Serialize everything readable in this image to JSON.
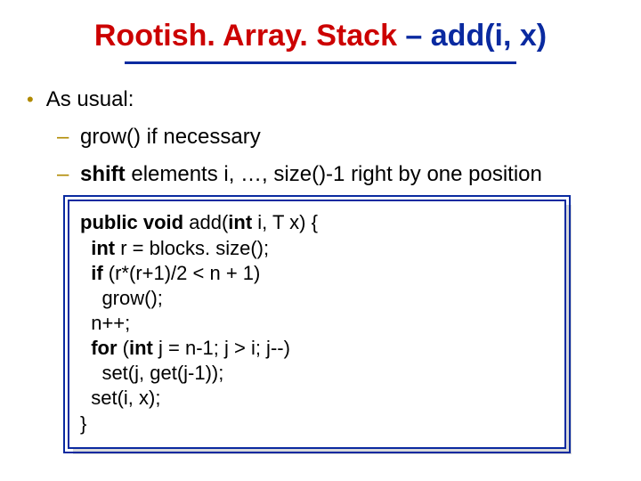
{
  "title": {
    "part1": "Rootish. Array. Stack ",
    "part2": "– add(i, x)"
  },
  "bullets": {
    "lvl1": "As usual:",
    "lvl2a_prefix": "grow() if necessary",
    "lvl2b_bold": "shift",
    "lvl2b_rest": " elements i, …, size()-1 right by one position"
  },
  "code": {
    "l1a": "public void ",
    "l1b": "add(",
    "l1c": "int ",
    "l1d": "i, T x) {",
    "l2a": "  int ",
    "l2b": "r = blocks. size();",
    "l3a": "  if ",
    "l3b": "(r*(r+1)/2 < n + 1)",
    "l4": "    grow();",
    "l5": "  n++;",
    "l6a": "  for ",
    "l6b": "(",
    "l6c": "int ",
    "l6d": "j = n-1; j > i; j--)",
    "l7": "    set(j, get(j-1));",
    "l8": "  set(i, x);",
    "l9": "}"
  }
}
